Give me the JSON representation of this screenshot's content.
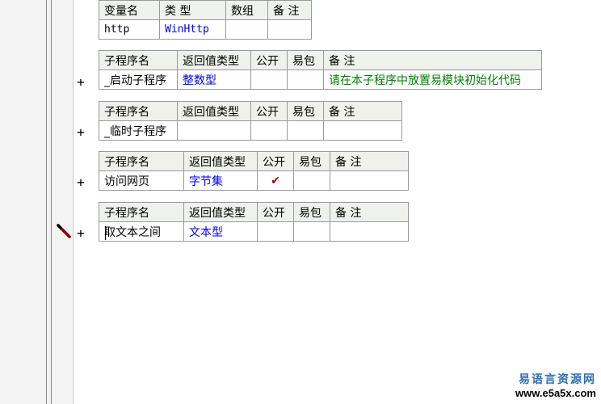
{
  "var_table": {
    "headers": [
      "变量名",
      "类 型",
      "数组",
      "备 注"
    ],
    "row": [
      "http",
      "WinHttp",
      "",
      ""
    ]
  },
  "subroutines": [
    {
      "headers": [
        "子程序名",
        "返回值类型",
        "公开",
        "易包",
        "备 注"
      ],
      "name": "_启动子程序",
      "return_type": "整数型",
      "public": "",
      "pkg": "",
      "note": "请在本子程序中放置易模块初始化代码"
    },
    {
      "headers": [
        "子程序名",
        "返回值类型",
        "公开",
        "易包",
        "备 注"
      ],
      "name": "_临时子程序",
      "return_type": "",
      "public": "",
      "pkg": "",
      "note": ""
    },
    {
      "headers": [
        "子程序名",
        "返回值类型",
        "公开",
        "易包",
        "备 注"
      ],
      "name": "访问网页",
      "return_type": "字节集",
      "public": "✔",
      "pkg": "",
      "note": ""
    },
    {
      "headers": [
        "子程序名",
        "返回值类型",
        "公开",
        "易包",
        "备 注"
      ],
      "name": "取文本之间",
      "return_type": "文本型",
      "public": "",
      "pkg": "",
      "note": ""
    }
  ],
  "plus_glyph": "+",
  "watermark": {
    "cn": "易语言资源网",
    "url": "www.e5a5x.com"
  },
  "colors": {
    "type_blue": "#0000ee",
    "note_green": "#008000",
    "check_red": "#a00000",
    "header_bg": "#eef1ec"
  },
  "icons": [
    "pencil-icon",
    "checkmark-icon"
  ]
}
